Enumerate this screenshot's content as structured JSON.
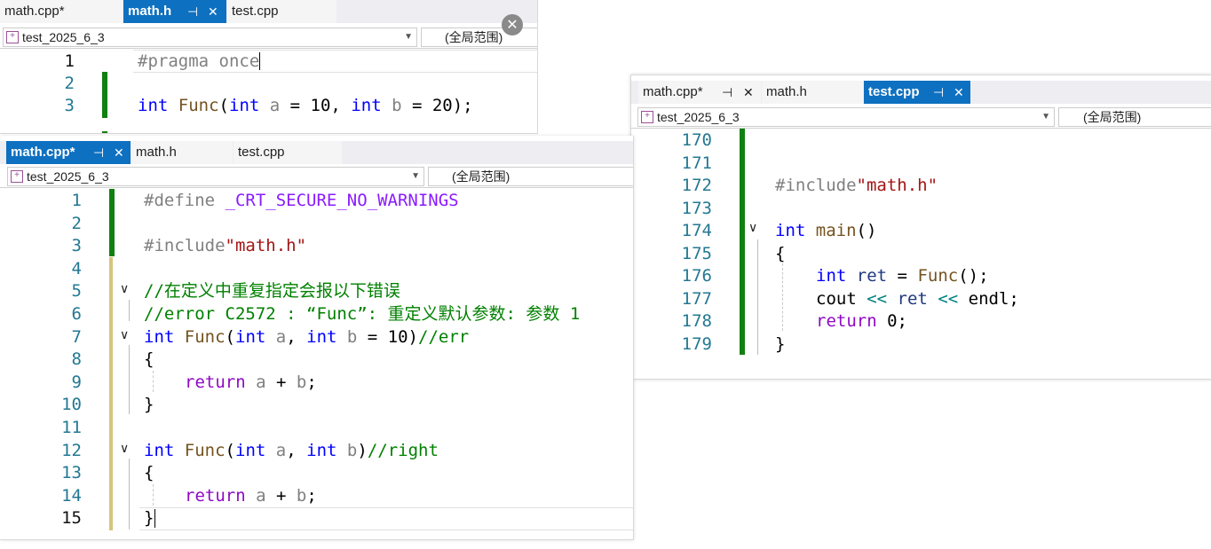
{
  "scope_label": "(全局范围)",
  "project": "test_2025_6_3",
  "pin_glyph": "⊣",
  "close_glyph": "✕",
  "window_a": {
    "tabs": [
      {
        "label": "math.cpp*"
      },
      {
        "label": "math.h"
      },
      {
        "label": "test.cpp"
      }
    ],
    "lines": [
      {
        "num": "1",
        "code": "#pragma once"
      },
      {
        "num": "2",
        "code": ""
      },
      {
        "num": "3",
        "code": "int Func(int a = 10, int b = 20);"
      }
    ]
  },
  "window_b": {
    "tabs": [
      {
        "label": "math.cpp*"
      },
      {
        "label": "math.h"
      },
      {
        "label": "test.cpp"
      }
    ],
    "lines": [
      {
        "num": "1",
        "code": "#define _CRT_SECURE_NO_WARNINGS"
      },
      {
        "num": "2",
        "code": ""
      },
      {
        "num": "3",
        "code": "#include\"math.h\""
      },
      {
        "num": "4",
        "code": ""
      },
      {
        "num": "5",
        "code": "//在定义中重复指定会报以下错误"
      },
      {
        "num": "6",
        "code": "//error C2572 : “Func”: 重定义默认参数: 参数 1"
      },
      {
        "num": "7",
        "code": "int Func(int a, int b = 10)//err"
      },
      {
        "num": "8",
        "code": "{"
      },
      {
        "num": "9",
        "code": "return a + b;"
      },
      {
        "num": "10",
        "code": "}"
      },
      {
        "num": "11",
        "code": ""
      },
      {
        "num": "12",
        "code": "int Func(int a, int b)//right"
      },
      {
        "num": "13",
        "code": "{"
      },
      {
        "num": "14",
        "code": "return a + b;"
      },
      {
        "num": "15",
        "code": "}"
      }
    ]
  },
  "window_c": {
    "tabs": [
      {
        "label": "math.cpp*"
      },
      {
        "label": "math.h"
      },
      {
        "label": "test.cpp"
      }
    ],
    "lines": [
      {
        "num": "170",
        "code": ""
      },
      {
        "num": "171",
        "code": ""
      },
      {
        "num": "172",
        "code": "#include\"math.h\""
      },
      {
        "num": "173",
        "code": ""
      },
      {
        "num": "174",
        "code": "int main()"
      },
      {
        "num": "175",
        "code": "{"
      },
      {
        "num": "176",
        "code": "int ret = Func();"
      },
      {
        "num": "177",
        "code": "cout << ret << endl;"
      },
      {
        "num": "178",
        "code": "return 0;"
      },
      {
        "num": "179",
        "code": "}"
      }
    ]
  },
  "colors": {
    "active_tab": "#0e70c0",
    "keyword": "#0000ff",
    "comment": "#008000",
    "string": "#a31515",
    "change_bar": "#108010"
  }
}
